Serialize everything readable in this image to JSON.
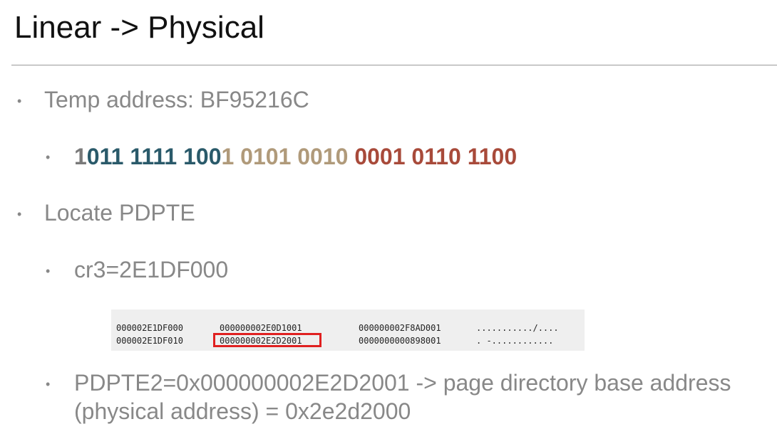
{
  "title": "Linear -> Physical",
  "bullets": {
    "temp": "Temp address: BF95216C",
    "binary": {
      "part1": "1",
      "part2": "011 1111 100",
      "part3": "1 0101 0010 ",
      "part4": "0001 0110 1100",
      "colors": {
        "part1": "#7a7a7a",
        "part2": "#2a5a6a",
        "part3": "#b09a7a",
        "part4": "#a84a3a"
      }
    },
    "locate": "Locate PDPTE",
    "cr3": "cr3=2E1DF000",
    "pdpte_line1": "PDPTE2=0x000000002E2D2001 -> page directory base address",
    "pdpte_line2": "(physical address) = 0x2e2d2000"
  },
  "dump": {
    "rows": [
      {
        "addr": "000002E1DF000",
        "q1": "000000002E0D1001",
        "q2": "000000002F8AD001",
        "ascii": ".........../...."
      },
      {
        "addr": "000002E1DF010",
        "q1": "000000002E2D2001",
        "q2": "0000000000898001",
        "ascii": ". -............"
      }
    ]
  }
}
